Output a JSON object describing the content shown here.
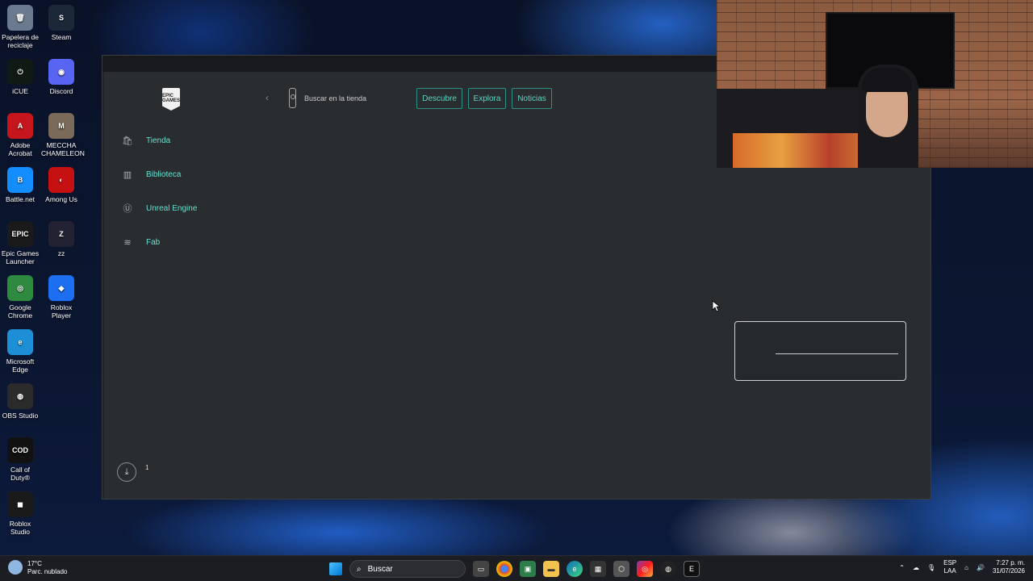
{
  "desktop": {
    "icons": [
      {
        "label": "Papelera de reciclaje",
        "glyph": "🗑",
        "color": "#6b7a8c"
      },
      {
        "label": "Steam",
        "glyph": "S",
        "color": "#1b2838"
      },
      {
        "label": "iCUE",
        "glyph": "⏻",
        "color": "#0f1a14"
      },
      {
        "label": "Discord",
        "glyph": "◉",
        "color": "#5865f2"
      },
      {
        "label": "Adobe Acrobat",
        "glyph": "A",
        "color": "#c4161c"
      },
      {
        "label": "MECCHA CHAMELEON",
        "glyph": "M",
        "color": "#7a6a5a"
      },
      {
        "label": "Battle.net",
        "glyph": "B",
        "color": "#148eff"
      },
      {
        "label": "Among Us",
        "glyph": "◐",
        "color": "#c51111"
      },
      {
        "label": "Epic Games Launcher",
        "glyph": "EPIC",
        "color": "#1a1a1a"
      },
      {
        "label": "zz",
        "glyph": "Z",
        "color": "#223"
      },
      {
        "label": "Google Chrome",
        "glyph": "◎",
        "color": "#2d8a3e"
      },
      {
        "label": "Roblox Player",
        "glyph": "◆",
        "color": "#1d6ff2"
      },
      {
        "label": "Microsoft Edge",
        "glyph": "e",
        "color": "#1c8fd6"
      },
      {
        "label": "OBS Studio",
        "glyph": "◍",
        "color": "#2b2b2b"
      },
      {
        "label": "Call of Duty®",
        "glyph": "COD",
        "color": "#111"
      },
      {
        "label": "Roblox Studio",
        "glyph": "◼",
        "color": "#1a1a1a"
      }
    ]
  },
  "epic": {
    "logo_text": "EPIC GAMES",
    "back_glyph": "‹",
    "search_placeholder": "Buscar en la tienda",
    "nav": {
      "discover": "Descubre",
      "explore": "Explora",
      "news": "Noticias"
    },
    "sidebar": [
      {
        "label": "Tienda",
        "icon": "bag-icon",
        "glyph": "🛍"
      },
      {
        "label": "Biblioteca",
        "icon": "library-icon",
        "glyph": "▥"
      },
      {
        "label": "Unreal Engine",
        "icon": "unreal-icon",
        "glyph": "Ⓤ"
      },
      {
        "label": "Fab",
        "icon": "fab-icon",
        "glyph": "≋"
      }
    ],
    "downloads_count": "1",
    "download_glyph": "⤓"
  },
  "taskbar": {
    "weather_temp": "17°C",
    "weather_desc": "Parc. nublado",
    "search_label": "Buscar",
    "lang_top": "ESP",
    "lang_bottom": "LAA",
    "time": "7:27 p. m.",
    "date": "31/07/2026"
  }
}
